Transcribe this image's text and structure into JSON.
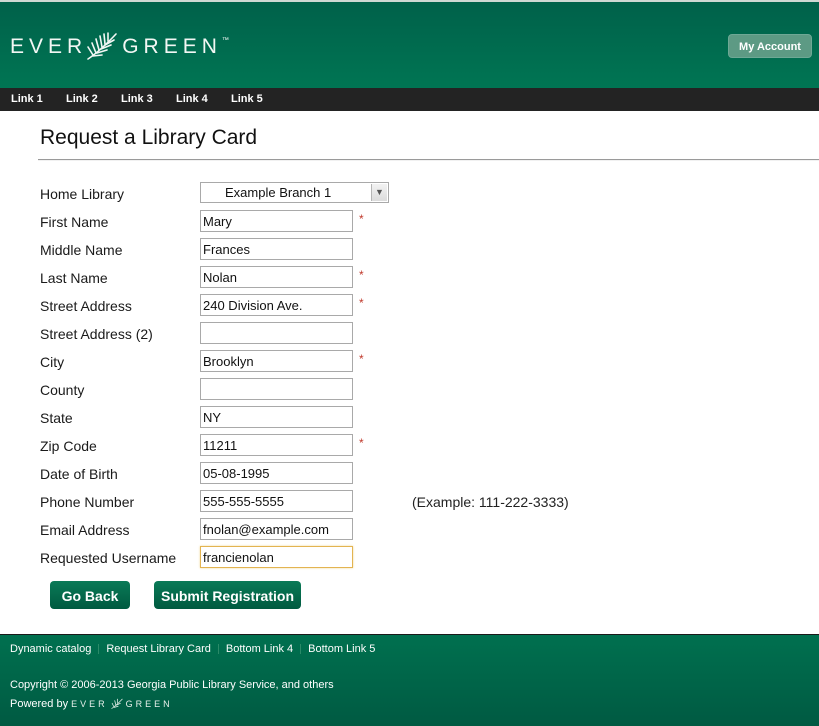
{
  "header": {
    "logo_left": "EVER",
    "logo_right": "GREEN",
    "logo_tm": "™",
    "my_account_label": "My Account",
    "colors": {
      "header_green": "#006b4e",
      "nav_bar": "#232323",
      "button_green": "#00694b"
    }
  },
  "topnav": {
    "links": [
      {
        "label": "Link 1"
      },
      {
        "label": "Link 2"
      },
      {
        "label": "Link 3"
      },
      {
        "label": "Link 4"
      },
      {
        "label": "Link 5"
      }
    ]
  },
  "page": {
    "title": "Request a Library Card"
  },
  "form": {
    "home_library": {
      "label": "Home Library",
      "selected": "Example Branch 1",
      "arrow_icon": "chevron-down-icon"
    },
    "fields": [
      {
        "label": "First Name",
        "value": "Mary",
        "required": true
      },
      {
        "label": "Middle Name",
        "value": "Frances",
        "required": false
      },
      {
        "label": "Last Name",
        "value": "Nolan",
        "required": true
      },
      {
        "label": "Street Address",
        "value": "240 Division Ave.",
        "required": true
      },
      {
        "label": "Street Address (2)",
        "value": "",
        "required": false
      },
      {
        "label": "City",
        "value": "Brooklyn",
        "required": true
      },
      {
        "label": "County",
        "value": "",
        "required": false
      },
      {
        "label": "State",
        "value": "NY",
        "required": false
      },
      {
        "label": "Zip Code",
        "value": "11211",
        "required": true
      },
      {
        "label": "Date of Birth",
        "value": "05-08-1995",
        "required": false
      },
      {
        "label": "Phone Number",
        "value": "555-555-5555",
        "required": false,
        "hint": "(Example: 111-222-3333)"
      },
      {
        "label": "Email Address",
        "value": "fnolan@example.com",
        "required": false
      },
      {
        "label": "Requested Username",
        "value": "francienolan",
        "required": false,
        "focused": true
      }
    ],
    "required_marker": "*",
    "go_back_label": "Go Back",
    "submit_label": "Submit Registration"
  },
  "footer": {
    "links": [
      {
        "label": "Dynamic catalog"
      },
      {
        "label": "Request Library Card"
      },
      {
        "label": "Bottom Link 4"
      },
      {
        "label": "Bottom Link 5"
      }
    ],
    "copyright": "Copyright © 2006-2013 Georgia Public Library Service, and others",
    "powered_by": "Powered by",
    "mini_logo_left": "EVER",
    "mini_logo_right": "GREEN"
  }
}
